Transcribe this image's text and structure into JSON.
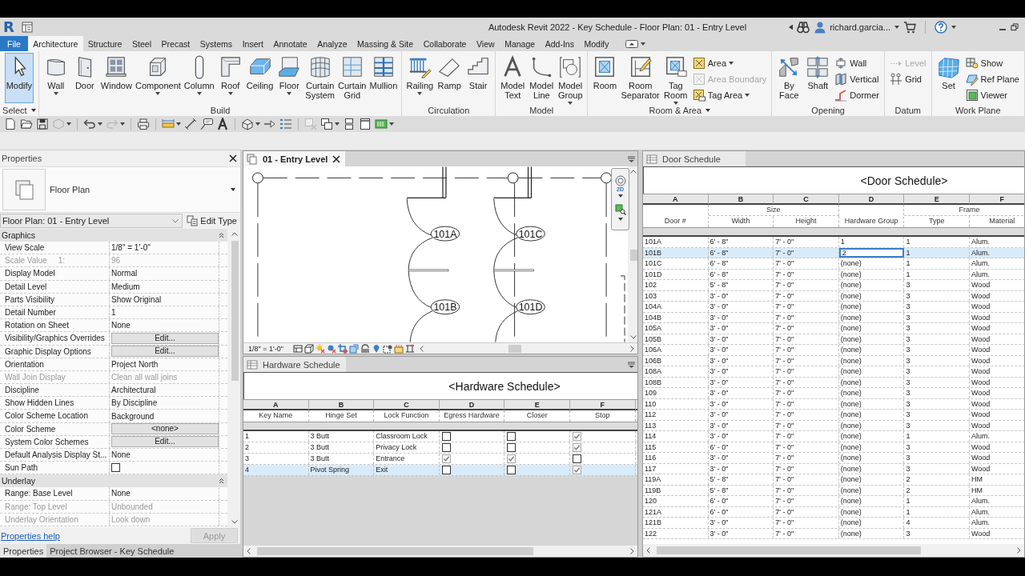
{
  "title_bar": {
    "logo": "R",
    "title": "Autodesk Revit 2022 - Key Schedule - Floor Plan: 01 - Entry Level",
    "user": "richard.garcia..."
  },
  "ribbon": {
    "tabs": [
      {
        "label": "File",
        "kind": "file",
        "selected": false
      },
      {
        "label": "Architecture",
        "kind": "tab",
        "selected": true
      },
      {
        "label": "Structure",
        "kind": "tab",
        "selected": false
      },
      {
        "label": "Steel",
        "kind": "tab",
        "selected": false
      },
      {
        "label": "Precast",
        "kind": "tab",
        "selected": false
      },
      {
        "label": "Systems",
        "kind": "tab",
        "selected": false
      },
      {
        "label": "Insert",
        "kind": "tab",
        "selected": false
      },
      {
        "label": "Annotate",
        "kind": "tab",
        "selected": false
      },
      {
        "label": "Analyze",
        "kind": "tab",
        "selected": false
      },
      {
        "label": "Massing & Site",
        "kind": "tab",
        "selected": false
      },
      {
        "label": "Collaborate",
        "kind": "tab",
        "selected": false
      },
      {
        "label": "View",
        "kind": "tab",
        "selected": false
      },
      {
        "label": "Manage",
        "kind": "tab",
        "selected": false
      },
      {
        "label": "Add-Ins",
        "kind": "tab",
        "selected": false
      },
      {
        "label": "Modify",
        "kind": "tab",
        "selected": false
      }
    ],
    "panels": [
      {
        "label": "Select",
        "menu": true,
        "tools": [
          {
            "label": "Modify",
            "kind": "large",
            "selected": true,
            "dropdown": false,
            "disabled": false
          }
        ]
      },
      {
        "label": "Build",
        "menu": false,
        "tools": [
          {
            "label": "Wall",
            "kind": "large",
            "selected": false,
            "dropdown": true,
            "disabled": false
          },
          {
            "label": "Door",
            "kind": "large",
            "selected": false,
            "dropdown": false,
            "disabled": false
          },
          {
            "label": "Window",
            "kind": "large",
            "selected": false,
            "dropdown": false,
            "disabled": false
          },
          {
            "label": "Component",
            "kind": "large",
            "selected": false,
            "dropdown": true,
            "disabled": false
          },
          {
            "label": "Column",
            "kind": "large",
            "selected": false,
            "dropdown": true,
            "disabled": false
          },
          {
            "label": "Roof",
            "kind": "large",
            "selected": false,
            "dropdown": true,
            "disabled": false
          },
          {
            "label": "Ceiling",
            "kind": "large",
            "selected": false,
            "dropdown": false,
            "disabled": false
          },
          {
            "label": "Floor",
            "kind": "large",
            "selected": false,
            "dropdown": true,
            "disabled": false
          },
          {
            "label": "Curtain System",
            "kind": "large",
            "selected": false,
            "dropdown": false,
            "disabled": false
          },
          {
            "label": "Curtain Grid",
            "kind": "large",
            "selected": false,
            "dropdown": false,
            "disabled": false
          },
          {
            "label": "Mullion",
            "kind": "large",
            "selected": false,
            "dropdown": false,
            "disabled": false
          }
        ]
      },
      {
        "label": "Circulation",
        "menu": false,
        "tools": [
          {
            "label": "Railing",
            "kind": "large",
            "selected": false,
            "dropdown": true,
            "disabled": false
          },
          {
            "label": "Ramp",
            "kind": "large",
            "selected": false,
            "dropdown": false,
            "disabled": false
          },
          {
            "label": "Stair",
            "kind": "large",
            "selected": false,
            "dropdown": false,
            "disabled": false
          }
        ]
      },
      {
        "label": "Model",
        "menu": false,
        "tools": [
          {
            "label": "Model Text",
            "kind": "large",
            "selected": false,
            "dropdown": false,
            "disabled": false
          },
          {
            "label": "Model Line",
            "kind": "large",
            "selected": false,
            "dropdown": false,
            "disabled": false
          },
          {
            "label": "Model Group",
            "kind": "large",
            "selected": false,
            "dropdown": true,
            "disabled": false
          }
        ]
      },
      {
        "label": "Room & Area",
        "menu": true,
        "tools": [
          {
            "label": "Room",
            "kind": "large",
            "selected": false,
            "dropdown": false,
            "disabled": false
          },
          {
            "label": "Room Separator",
            "kind": "large",
            "selected": false,
            "dropdown": false,
            "disabled": false
          },
          {
            "label": "Tag Room",
            "kind": "large",
            "selected": false,
            "dropdown": true,
            "disabled": false
          },
          {
            "label": "Area",
            "kind": "small",
            "selected": false,
            "dropdown": true,
            "disabled": false
          },
          {
            "label": "Area Boundary",
            "kind": "small",
            "selected": false,
            "dropdown": false,
            "disabled": true
          },
          {
            "label": "Tag Area",
            "kind": "small",
            "selected": false,
            "dropdown": true,
            "disabled": false
          }
        ]
      },
      {
        "label": "Opening",
        "menu": false,
        "tools": [
          {
            "label": "By Face",
            "kind": "large",
            "selected": false,
            "dropdown": false,
            "disabled": false
          },
          {
            "label": "Shaft",
            "kind": "large",
            "selected": false,
            "dropdown": false,
            "disabled": false
          },
          {
            "label": "Wall",
            "kind": "small",
            "selected": false,
            "dropdown": false,
            "disabled": false
          },
          {
            "label": "Vertical",
            "kind": "small",
            "selected": false,
            "dropdown": false,
            "disabled": false
          },
          {
            "label": "Dormer",
            "kind": "small",
            "selected": false,
            "dropdown": false,
            "disabled": false
          }
        ]
      },
      {
        "label": "Datum",
        "menu": false,
        "tools": [
          {
            "label": "Level",
            "kind": "small",
            "selected": false,
            "dropdown": false,
            "disabled": true
          },
          {
            "label": "Grid",
            "kind": "small",
            "selected": false,
            "dropdown": false,
            "disabled": false
          }
        ]
      },
      {
        "label": "Work Plane",
        "menu": false,
        "tools": [
          {
            "label": "Set",
            "kind": "large",
            "selected": false,
            "dropdown": false,
            "disabled": false
          },
          {
            "label": "Show",
            "kind": "small",
            "selected": false,
            "dropdown": false,
            "disabled": false
          },
          {
            "label": "Ref Plane",
            "kind": "small",
            "selected": false,
            "dropdown": false,
            "disabled": false
          },
          {
            "label": "Viewer",
            "kind": "small",
            "selected": false,
            "dropdown": false,
            "disabled": false
          }
        ]
      }
    ]
  },
  "properties": {
    "title": "Properties",
    "type_name": "Floor Plan",
    "instance": "Floor Plan: 01 - Entry Level",
    "edit_type": "Edit Type",
    "groups": [
      {
        "label": "Graphics",
        "expanded": true,
        "rows": [
          {
            "label": "View Scale",
            "value": "1/8\" = 1'-0\"",
            "kind": "text",
            "disabled": false
          },
          {
            "label": "Scale Value",
            "unit": "1:",
            "value": "96",
            "kind": "text",
            "disabled": true
          },
          {
            "label": "Display Model",
            "value": "Normal",
            "kind": "text",
            "disabled": false
          },
          {
            "label": "Detail Level",
            "value": "Medium",
            "kind": "text",
            "disabled": false
          },
          {
            "label": "Parts Visibility",
            "value": "Show Original",
            "kind": "text",
            "disabled": false
          },
          {
            "label": "Detail Number",
            "value": "1",
            "kind": "text",
            "disabled": false
          },
          {
            "label": "Rotation on Sheet",
            "value": "None",
            "kind": "text",
            "disabled": false
          },
          {
            "label": "Visibility/Graphics Overrides",
            "value": "Edit...",
            "kind": "button",
            "disabled": false
          },
          {
            "label": "Graphic Display Options",
            "value": "Edit...",
            "kind": "button",
            "disabled": false
          },
          {
            "label": "Orientation",
            "value": "Project North",
            "kind": "text",
            "disabled": false
          },
          {
            "label": "Wall Join Display",
            "value": "Clean all wall joins",
            "kind": "text",
            "disabled": true
          },
          {
            "label": "Discipline",
            "value": "Architectural",
            "kind": "text",
            "disabled": false
          },
          {
            "label": "Show Hidden Lines",
            "value": "By Discipline",
            "kind": "text",
            "disabled": false
          },
          {
            "label": "Color Scheme Location",
            "value": "Background",
            "kind": "text",
            "disabled": false
          },
          {
            "label": "Color Scheme",
            "value": "<none>",
            "kind": "button",
            "disabled": false
          },
          {
            "label": "System Color Schemes",
            "value": "Edit...",
            "kind": "button",
            "disabled": false
          },
          {
            "label": "Default Analysis Display St...",
            "value": "None",
            "kind": "text",
            "disabled": false
          },
          {
            "label": "Sun Path",
            "kind": "checkbox",
            "checked": false,
            "disabled": false
          }
        ]
      },
      {
        "label": "Underlay",
        "expanded": true,
        "rows": [
          {
            "label": "Range: Base Level",
            "value": "None",
            "kind": "text",
            "disabled": false
          },
          {
            "label": "Range: Top Level",
            "value": "Unbounded",
            "kind": "text",
            "disabled": true
          },
          {
            "label": "Underlay Orientation",
            "value": "Look down",
            "kind": "text",
            "disabled": true
          }
        ]
      }
    ],
    "help": "Properties help",
    "apply": {
      "label": "Apply",
      "disabled": true
    },
    "tabs": [
      {
        "label": "Properties",
        "selected": true
      },
      {
        "label": "Project Browser - Key Schedule",
        "selected": false
      }
    ]
  },
  "view": {
    "title": "01 - Entry Level",
    "nav_label": "2D",
    "tags": [
      "101A",
      "101C",
      "101B",
      "101D"
    ],
    "scale": "1/8\" = 1'-0\""
  },
  "hardware_schedule": {
    "title": "Hardware Schedule",
    "heading": "<Hardware Schedule>",
    "letters": [
      "A",
      "B",
      "C",
      "D",
      "E",
      "F"
    ],
    "columns": [
      "Key Name",
      "Hinge Set",
      "Lock Function",
      "Egress Hardware",
      "Closer",
      "Stop"
    ],
    "rows": [
      {
        "cells": [
          "1",
          "3 Butt",
          "Classroom Lock"
        ],
        "checks": [
          false,
          false,
          true
        ],
        "selected": false
      },
      {
        "cells": [
          "2",
          "3 Butt",
          "Privacy Lock"
        ],
        "checks": [
          false,
          false,
          true
        ],
        "selected": false
      },
      {
        "cells": [
          "3",
          "3 Butt",
          "Entrance"
        ],
        "checks": [
          true,
          true,
          false
        ],
        "selected": false
      },
      {
        "cells": [
          "4",
          "Pivot Spring",
          "Exit"
        ],
        "checks": [
          false,
          false,
          true
        ],
        "selected": true
      }
    ]
  },
  "door_schedule": {
    "title": "Door Schedule",
    "heading": "<Door Schedule>",
    "letters": [
      "A",
      "B",
      "C",
      "D",
      "E",
      "F"
    ],
    "columns": [
      {
        "label": "Door #",
        "focused": false,
        "in_group": false
      },
      {
        "label": "Width",
        "group": "Size",
        "focused": false,
        "in_group": false
      },
      {
        "label": "Height",
        "focused": false,
        "in_group": true
      },
      {
        "label": "Hardware Group",
        "focused": true,
        "in_group": false
      },
      {
        "label": "Type",
        "group": "Frame",
        "focused": false,
        "in_group": false
      },
      {
        "label": "Material",
        "focused": false,
        "in_group": true
      }
    ],
    "rows": [
      {
        "cells": [
          "101A",
          "6' - 8\"",
          "7' - 0\"",
          "1",
          "1",
          "Alum."
        ],
        "selected": false
      },
      {
        "cells": [
          "101B",
          "6' - 8\"",
          "7' - 0\"",
          "2",
          "1",
          "Alum."
        ],
        "selected": true
      },
      {
        "cells": [
          "101C",
          "6' - 8\"",
          "7' - 0\"",
          "(none)",
          "1",
          "Alum."
        ],
        "selected": false
      },
      {
        "cells": [
          "101D",
          "6' - 8\"",
          "7' - 0\"",
          "(none)",
          "1",
          "Alum."
        ],
        "selected": false
      },
      {
        "cells": [
          "102",
          "5' - 8\"",
          "7' - 0\"",
          "(none)",
          "3",
          "Wood"
        ],
        "selected": false
      },
      {
        "cells": [
          "103",
          "3' - 0\"",
          "7' - 0\"",
          "(none)",
          "3",
          "Wood"
        ],
        "selected": false
      },
      {
        "cells": [
          "104A",
          "3' - 0\"",
          "7' - 0\"",
          "(none)",
          "3",
          "Wood"
        ],
        "selected": false
      },
      {
        "cells": [
          "104B",
          "3' - 0\"",
          "7' - 0\"",
          "(none)",
          "3",
          "Wood"
        ],
        "selected": false
      },
      {
        "cells": [
          "105A",
          "3' - 0\"",
          "7' - 0\"",
          "(none)",
          "3",
          "Wood"
        ],
        "selected": false
      },
      {
        "cells": [
          "105B",
          "3' - 0\"",
          "7' - 0\"",
          "(none)",
          "3",
          "Wood"
        ],
        "selected": false
      },
      {
        "cells": [
          "106A",
          "3' - 0\"",
          "7' - 0\"",
          "(none)",
          "3",
          "Wood"
        ],
        "selected": false
      },
      {
        "cells": [
          "106B",
          "3' - 0\"",
          "7' - 0\"",
          "(none)",
          "3",
          "Wood"
        ],
        "selected": false
      },
      {
        "cells": [
          "108A",
          "3' - 0\"",
          "7' - 0\"",
          "(none)",
          "3",
          "Wood"
        ],
        "selected": false
      },
      {
        "cells": [
          "108B",
          "3' - 0\"",
          "7' - 0\"",
          "(none)",
          "3",
          "Wood"
        ],
        "selected": false
      },
      {
        "cells": [
          "109",
          "3' - 0\"",
          "7' - 0\"",
          "(none)",
          "3",
          "Wood"
        ],
        "selected": false
      },
      {
        "cells": [
          "110",
          "3' - 0\"",
          "7' - 0\"",
          "(none)",
          "3",
          "Wood"
        ],
        "selected": false
      },
      {
        "cells": [
          "112",
          "3' - 0\"",
          "7' - 0\"",
          "(none)",
          "3",
          "Wood"
        ],
        "selected": false
      },
      {
        "cells": [
          "113",
          "3' - 0\"",
          "7' - 0\"",
          "(none)",
          "3",
          "Wood"
        ],
        "selected": false
      },
      {
        "cells": [
          "114",
          "3' - 0\"",
          "7' - 0\"",
          "(none)",
          "1",
          "Alum."
        ],
        "selected": false
      },
      {
        "cells": [
          "115",
          "6' - 0\"",
          "7' - 0\"",
          "(none)",
          "3",
          "Wood"
        ],
        "selected": false
      },
      {
        "cells": [
          "116",
          "3' - 0\"",
          "7' - 0\"",
          "(none)",
          "3",
          "Wood"
        ],
        "selected": false
      },
      {
        "cells": [
          "117",
          "3' - 0\"",
          "7' - 0\"",
          "(none)",
          "3",
          "Wood"
        ],
        "selected": false
      },
      {
        "cells": [
          "119A",
          "5' - 8\"",
          "7' - 0\"",
          "(none)",
          "2",
          "HM"
        ],
        "selected": false
      },
      {
        "cells": [
          "119B",
          "5' - 8\"",
          "7' - 0\"",
          "(none)",
          "2",
          "HM"
        ],
        "selected": false
      },
      {
        "cells": [
          "120",
          "6' - 0\"",
          "7' - 0\"",
          "(none)",
          "1",
          "Alum."
        ],
        "selected": false
      },
      {
        "cells": [
          "121A",
          "6' - 0\"",
          "7' - 0\"",
          "(none)",
          "1",
          "Alum."
        ],
        "selected": false
      },
      {
        "cells": [
          "121B",
          "3' - 0\"",
          "7' - 0\"",
          "(none)",
          "4",
          "Alum."
        ],
        "selected": false
      },
      {
        "cells": [
          "122",
          "3' - 0\"",
          "7' - 0\"",
          "(none)",
          "3",
          "Wood"
        ],
        "selected": false
      }
    ]
  }
}
